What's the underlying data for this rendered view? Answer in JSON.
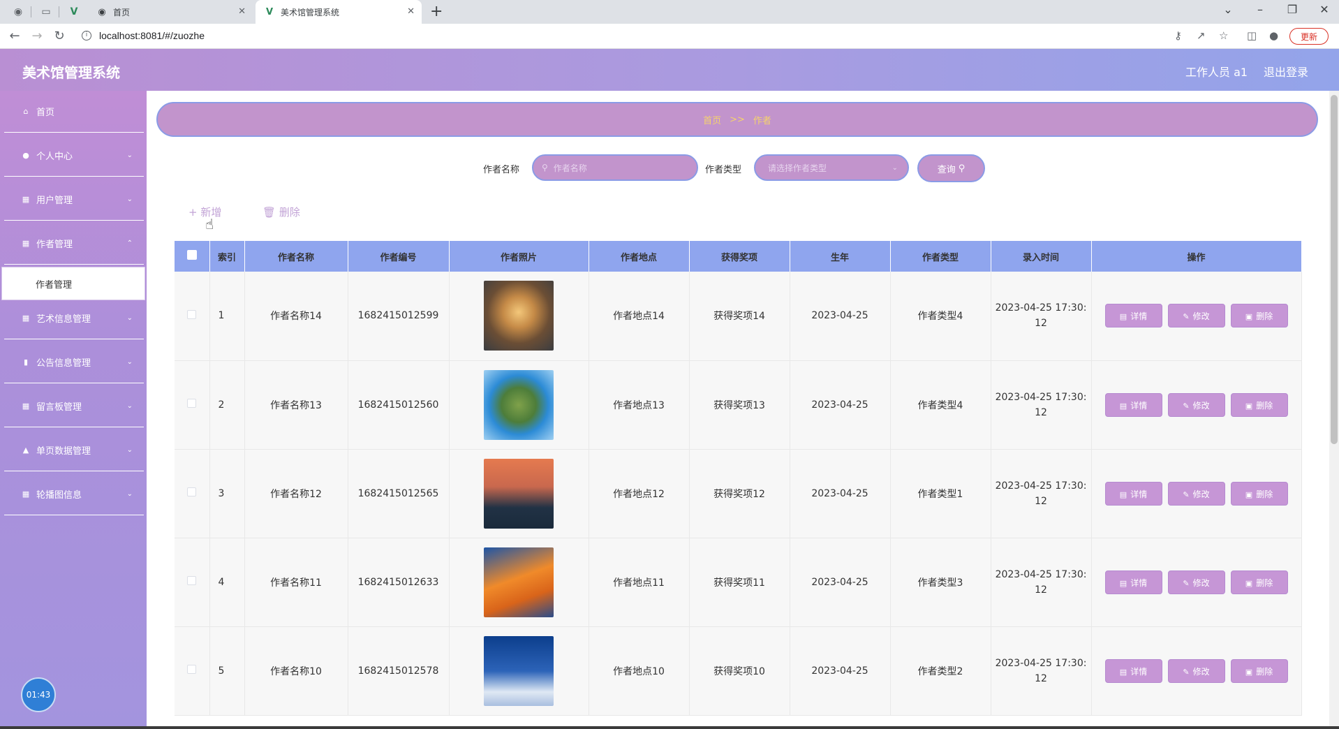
{
  "browser": {
    "tabs": [
      {
        "label": "首页",
        "active": false
      },
      {
        "label": "美术馆管理系统",
        "active": true
      }
    ],
    "url": "localhost:8081/#/zuozhe",
    "update_label": "更新"
  },
  "header": {
    "title": "美术馆管理系统",
    "user": "工作人员 a1",
    "logout": "退出登录"
  },
  "sidebar": {
    "items": [
      {
        "label": "首页",
        "icon": "home-icon",
        "has_children": false
      },
      {
        "label": "个人中心",
        "icon": "person-icon",
        "has_children": true
      },
      {
        "label": "用户管理",
        "icon": "grid-icon",
        "has_children": true
      },
      {
        "label": "作者管理",
        "icon": "grid-icon",
        "has_children": true
      },
      {
        "label": "艺术信息管理",
        "icon": "grid-icon",
        "has_children": true
      },
      {
        "label": "公告信息管理",
        "icon": "chart-icon",
        "has_children": true
      },
      {
        "label": "留言板管理",
        "icon": "grid-icon",
        "has_children": true
      },
      {
        "label": "单页数据管理",
        "icon": "data-icon",
        "has_children": true
      },
      {
        "label": "轮播图信息",
        "icon": "grid-icon",
        "has_children": true
      }
    ],
    "active_sub": "作者管理",
    "clock": "01:43"
  },
  "breadcrumb": {
    "home": "首页",
    "sep": ">>",
    "current": "作者"
  },
  "search": {
    "name_label": "作者名称",
    "name_placeholder": "作者名称",
    "type_label": "作者类型",
    "type_placeholder": "请选择作者类型",
    "query_label": "查询"
  },
  "toolbar": {
    "add_label": "新增",
    "delete_label": "删除"
  },
  "table": {
    "headers": [
      "索引",
      "作者名称",
      "作者编号",
      "作者照片",
      "作者地点",
      "获得奖项",
      "生年",
      "作者类型",
      "录入时间",
      "操作"
    ],
    "rows": [
      {
        "index": "1",
        "name": "作者名称14",
        "code": "1682415012599",
        "photo": "sunset-field",
        "place": "作者地点14",
        "award": "获得奖项14",
        "year": "2023-04-25",
        "type": "作者类型4",
        "time1": "2023-04-25 17:30:",
        "time2": "12"
      },
      {
        "index": "2",
        "name": "作者名称13",
        "code": "1682415012560",
        "photo": "planet-island",
        "place": "作者地点13",
        "award": "获得奖项13",
        "year": "2023-04-25",
        "type": "作者类型4",
        "time1": "2023-04-25 17:30:",
        "time2": "12"
      },
      {
        "index": "3",
        "name": "作者名称12",
        "code": "1682415012565",
        "photo": "lake-moon",
        "place": "作者地点12",
        "award": "获得奖项12",
        "year": "2023-04-25",
        "type": "作者类型1",
        "time1": "2023-04-25 17:30:",
        "time2": "12"
      },
      {
        "index": "4",
        "name": "作者名称11",
        "code": "1682415012633",
        "photo": "orange-mountain",
        "place": "作者地点11",
        "award": "获得奖项11",
        "year": "2023-04-25",
        "type": "作者类型3",
        "time1": "2023-04-25 17:30:",
        "time2": "12"
      },
      {
        "index": "5",
        "name": "作者名称10",
        "code": "1682415012578",
        "photo": "snow-cabin",
        "place": "作者地点10",
        "award": "获得奖项10",
        "year": "2023-04-25",
        "type": "作者类型2",
        "time1": "2023-04-25 17:30:",
        "time2": "12"
      }
    ],
    "actions": {
      "detail": "详情",
      "edit": "修改",
      "delete": "删除"
    }
  }
}
